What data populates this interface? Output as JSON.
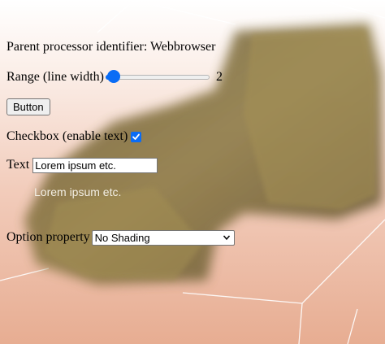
{
  "processor": {
    "label": "Parent processor identifier: Webbrowser"
  },
  "range": {
    "label": "Range (line width)",
    "value": "2",
    "fraction": 0.0
  },
  "button": {
    "label": "Button"
  },
  "checkbox": {
    "label": "Checkbox (enable text)",
    "checked": true
  },
  "text": {
    "label": "Text",
    "value": "Lorem ipsum etc.",
    "echo": "Lorem ipsum etc."
  },
  "option": {
    "label": "Option property",
    "selected": "No Shading"
  },
  "colors": {
    "accent": "#0a6cf5",
    "background_top": "#ffffff",
    "background_bottom": "#e7ad92",
    "volume": "#8c7a45"
  },
  "icons": {
    "checkbox": "checkmark-icon",
    "select": "chevron-down-icon"
  }
}
